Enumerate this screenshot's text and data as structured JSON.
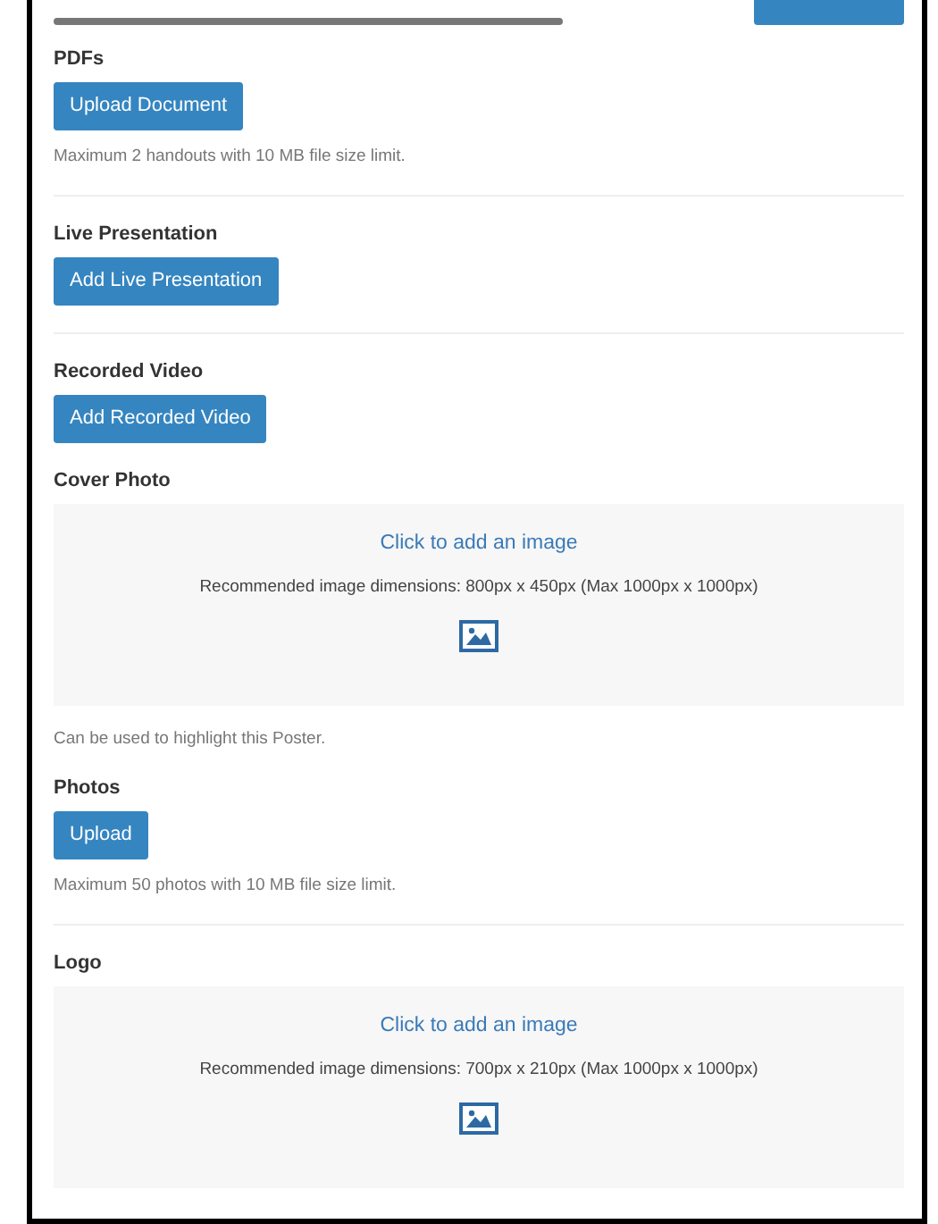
{
  "sections": [
    {
      "heading": "PDFs",
      "kind": "upload",
      "button": "Upload Document",
      "note": "Maximum 2 handouts with 10 MB file size limit.",
      "divider": true
    },
    {
      "heading": "Live Presentation",
      "kind": "upload",
      "button": "Add Live Presentation",
      "divider": true
    },
    {
      "heading": "Recorded Video",
      "kind": "upload",
      "button": "Add Recorded Video",
      "divider": false
    },
    {
      "heading": "Cover Photo",
      "kind": "dropzone",
      "link": "Click to add an image",
      "hint": "Recommended image dimensions: 800px x 450px (Max 1000px x 1000px)",
      "note": "Can be used to highlight this Poster.",
      "divider": false
    },
    {
      "heading": "Photos",
      "kind": "upload",
      "button": "Upload",
      "note": "Maximum 50 photos with 10 MB file size limit.",
      "divider": true
    },
    {
      "heading": "Logo",
      "kind": "dropzone",
      "link": "Click to add an image",
      "hint": "Recommended image dimensions: 700px x 210px (Max 1000px x 1000px)",
      "divider": false
    }
  ]
}
